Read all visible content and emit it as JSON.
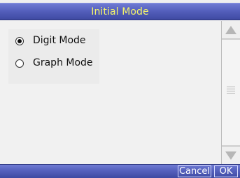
{
  "window": {
    "title": "Initial Mode"
  },
  "options": [
    {
      "label": "Digit Mode",
      "selected": true
    },
    {
      "label": "Graph Mode",
      "selected": false
    }
  ],
  "footer": {
    "cancel_label": "Cancel",
    "ok_label": "OK"
  },
  "colors": {
    "title_bar": "#5560bd",
    "title_text": "#f4f46a",
    "content_bg": "#f1f1f1",
    "scrollbar_arrow": "#b6b6b6"
  },
  "icons": {
    "selected_radio": "radio-button-selected-icon",
    "unselected_radio": "radio-button-unselected-icon",
    "scroll_up": "up-triangle-icon",
    "scroll_down": "down-triangle-icon",
    "scroll_grip": "grip-lines-icon"
  }
}
